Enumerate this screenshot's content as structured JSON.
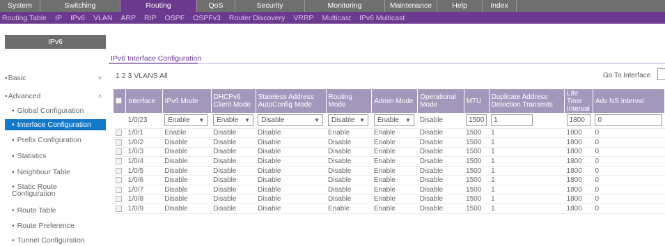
{
  "top_nav": [
    {
      "label": "System",
      "width": 58
    },
    {
      "label": "Switching",
      "width": 115
    },
    {
      "label": "Routing",
      "width": 110,
      "active": true
    },
    {
      "label": "QoS",
      "width": 55
    },
    {
      "label": "Security",
      "width": 100
    },
    {
      "label": "Monitoring",
      "width": 115
    },
    {
      "label": "Maintenance",
      "width": 75
    },
    {
      "label": "Help",
      "width": 65
    },
    {
      "label": "Index",
      "width": 49
    }
  ],
  "sub_nav": [
    "Routing Table",
    "IP",
    "IPv6",
    "VLAN",
    "ARP",
    "RIP",
    "OSPF",
    "OSPFv3",
    "Router Discovery",
    "VRRP",
    "Multicast",
    "IPv6 Multicast"
  ],
  "sub_nav_active": "IPv6",
  "sidebar": {
    "title": "IPv6",
    "items": [
      {
        "label": "Basic",
        "chev": "˅"
      },
      {
        "label": "Advanced",
        "chev": "˄"
      },
      {
        "label": "Global Configuration"
      },
      {
        "label": "Interface Configuration",
        "selected": true
      },
      {
        "label": "Prefix Configuration"
      },
      {
        "label": "Statistics"
      },
      {
        "label": "Neighbour Table"
      },
      {
        "label": "Static Route\nConfiguration"
      },
      {
        "label": "Route Table"
      },
      {
        "label": "Route Preference"
      },
      {
        "label": "Tunnel Configuration"
      }
    ]
  },
  "page_tab": "IPv6 Interface Configuration",
  "filter_text": "1 2 3 VLANS All",
  "goto_label": "Go To Interface",
  "table": {
    "headers": [
      "Interface",
      "IPv6 Mode",
      "DHCPv6 Client Mode",
      "Stateless Address AutoConfig Mode",
      "Routing Mode",
      "Admin Mode",
      "Operational Mode",
      "MTU",
      "Duplicate Address Detection Transmits",
      "Life Time Interval",
      "Adv NS Interval"
    ],
    "edit_row": {
      "interface": "1/0/23",
      "ipv6_mode": "Enable",
      "dhcp_mode": "Enable",
      "stateless": "Disable",
      "routing": "Disable",
      "admin": "Enable",
      "operational": "Disable",
      "mtu": "1500",
      "dad": "1",
      "lifetime": "1800",
      "advns": "0"
    },
    "rows": [
      [
        "1/0/1",
        "Enable",
        "Disable",
        "Disable",
        "Enable",
        "Enable",
        "Disable",
        "1500",
        "1",
        "1800",
        "0"
      ],
      [
        "1/0/2",
        "Disable",
        "Disable",
        "Disable",
        "Disable",
        "Enable",
        "Disable",
        "1500",
        "1",
        "1800",
        "0"
      ],
      [
        "1/0/3",
        "Disable",
        "Disable",
        "Disable",
        "Disable",
        "Enable",
        "Disable",
        "1500",
        "1",
        "1800",
        "0"
      ],
      [
        "1/0/4",
        "Disable",
        "Disable",
        "Disable",
        "Disable",
        "Enable",
        "Disable",
        "1500",
        "1",
        "1800",
        "0"
      ],
      [
        "1/0/5",
        "Disable",
        "Disable",
        "Disable",
        "Disable",
        "Enable",
        "Disable",
        "1500",
        "1",
        "1800",
        "0"
      ],
      [
        "1/0/6",
        "Disable",
        "Disable",
        "Disable",
        "Disable",
        "Enable",
        "Disable",
        "1500",
        "1",
        "1800",
        "0"
      ],
      [
        "1/0/7",
        "Disable",
        "Disable",
        "Disable",
        "Disable",
        "Enable",
        "Disable",
        "1500",
        "1",
        "1800",
        "0"
      ],
      [
        "1/0/8",
        "Disable",
        "Disable",
        "Disable",
        "Disable",
        "Enable",
        "Disable",
        "1500",
        "1",
        "1800",
        "0"
      ],
      [
        "1/0/9",
        "Disable",
        "Disable",
        "Disable",
        "Enable",
        "Enable",
        "Disable",
        "1500",
        "1",
        "1800",
        "0"
      ]
    ]
  },
  "colors": {
    "accent": "#6b3a8e",
    "header": "#a497bc",
    "selected": "#1478c8"
  }
}
